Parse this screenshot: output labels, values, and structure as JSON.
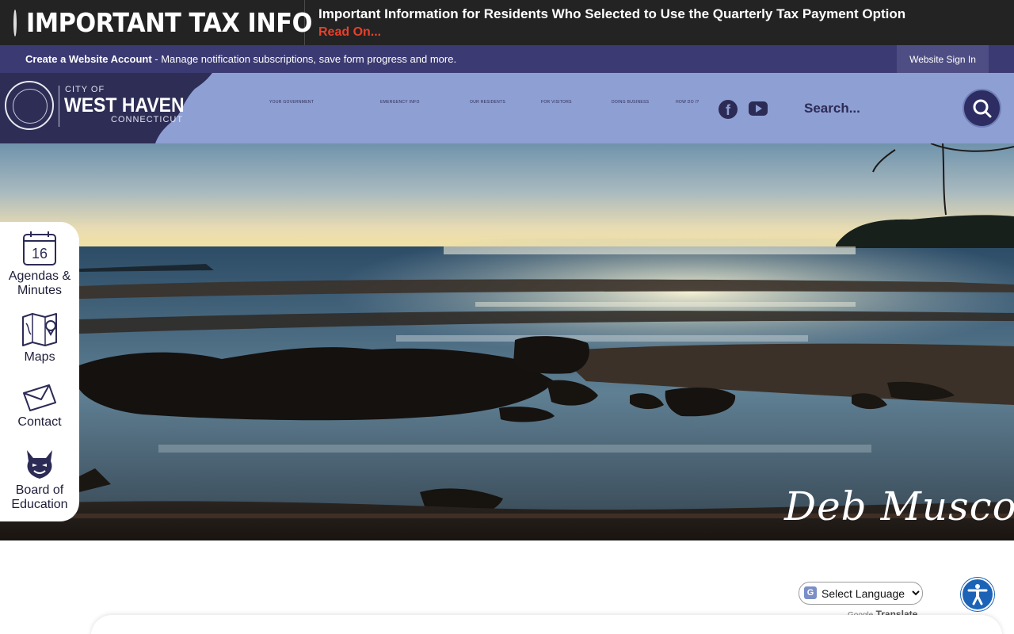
{
  "alert": {
    "title": "IMPORTANT TAX INFO",
    "headline": "Important Information for Residents Who Selected to Use the Quarterly Tax Payment Option",
    "link": "Read On..."
  },
  "account_bar": {
    "create_account": "Create a Website Account",
    "description": " - Manage notification subscriptions, save form progress and more.",
    "signin_label": "Website Sign In"
  },
  "logo": {
    "city_of": "CITY OF",
    "name": "WEST HAVEN",
    "state": "CONNECTICUT"
  },
  "nav": {
    "items": [
      "YOUR GOVERNMENT",
      "EMERGENCY INFO",
      "OUR RESIDENTS",
      "FOR VISITORS",
      "DOING BUSINESS",
      "HOW DO I?"
    ]
  },
  "social": {
    "facebook_icon": "facebook-icon",
    "youtube_icon": "youtube-icon"
  },
  "search": {
    "placeholder": "Search...",
    "icon": "search-icon"
  },
  "quick_links": {
    "calendar_day": "16",
    "items": [
      {
        "label": "Agendas &",
        "label2": "Minutes",
        "icon": "calendar-icon"
      },
      {
        "label": "Maps",
        "icon": "map-icon"
      },
      {
        "label": "Contact",
        "icon": "envelope-icon"
      },
      {
        "label": "Board of",
        "label2": "Education",
        "icon": "mascot-icon"
      }
    ]
  },
  "hero": {
    "signature": "Deb Musco"
  },
  "translate": {
    "select_value": "Select Language",
    "powered_by": "Google",
    "translate_label": "Translate"
  },
  "accessibility": {
    "icon": "accessibility-icon"
  },
  "colors": {
    "alert_bg": "#232323",
    "alert_link": "#e8402c",
    "account_bar": "#3b3a73",
    "header_bg": "#8e9fd3",
    "brand_dark": "#2c2b55",
    "accessibility": "#1c63b7"
  }
}
